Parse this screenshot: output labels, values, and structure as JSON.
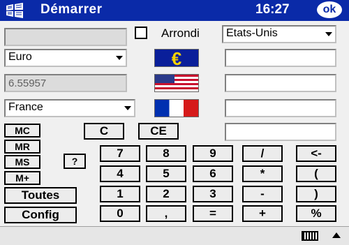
{
  "titlebar": {
    "title": "Démarrer",
    "time": "16:27",
    "ok_label": "ok",
    "start_icon": "windows-flag-icon"
  },
  "top": {
    "amount_field": "",
    "arrondi_label": "Arrondi",
    "arrondi_checked": false,
    "target_currency": "Etats-Unis"
  },
  "row_euro": {
    "currency": "Euro",
    "flag": "euro-flag-icon",
    "eu_symbol": "€",
    "result": ""
  },
  "row_rate": {
    "rate": "6.55957",
    "flag": "us-flag-icon",
    "result": ""
  },
  "row_france": {
    "currency": "France",
    "flag": "france-flag-icon",
    "result": ""
  },
  "row_extra": {
    "result": ""
  },
  "memory": {
    "mc": "MC",
    "mr": "MR",
    "ms": "MS",
    "mplus": "M+",
    "help": "?",
    "toutes": "Toutes",
    "config": "Config"
  },
  "clear": {
    "c": "C",
    "ce": "CE"
  },
  "keypad": {
    "row1": [
      "7",
      "8",
      "9",
      "/",
      "<-"
    ],
    "row2": [
      "4",
      "5",
      "6",
      "*",
      "("
    ],
    "row3": [
      "1",
      "2",
      "3",
      "-",
      ")"
    ],
    "row4": [
      "0",
      ",",
      "=",
      "+",
      "%"
    ]
  },
  "statusbar": {
    "keyboard_icon": "keyboard-icon",
    "up_icon": "up-arrow-icon"
  }
}
